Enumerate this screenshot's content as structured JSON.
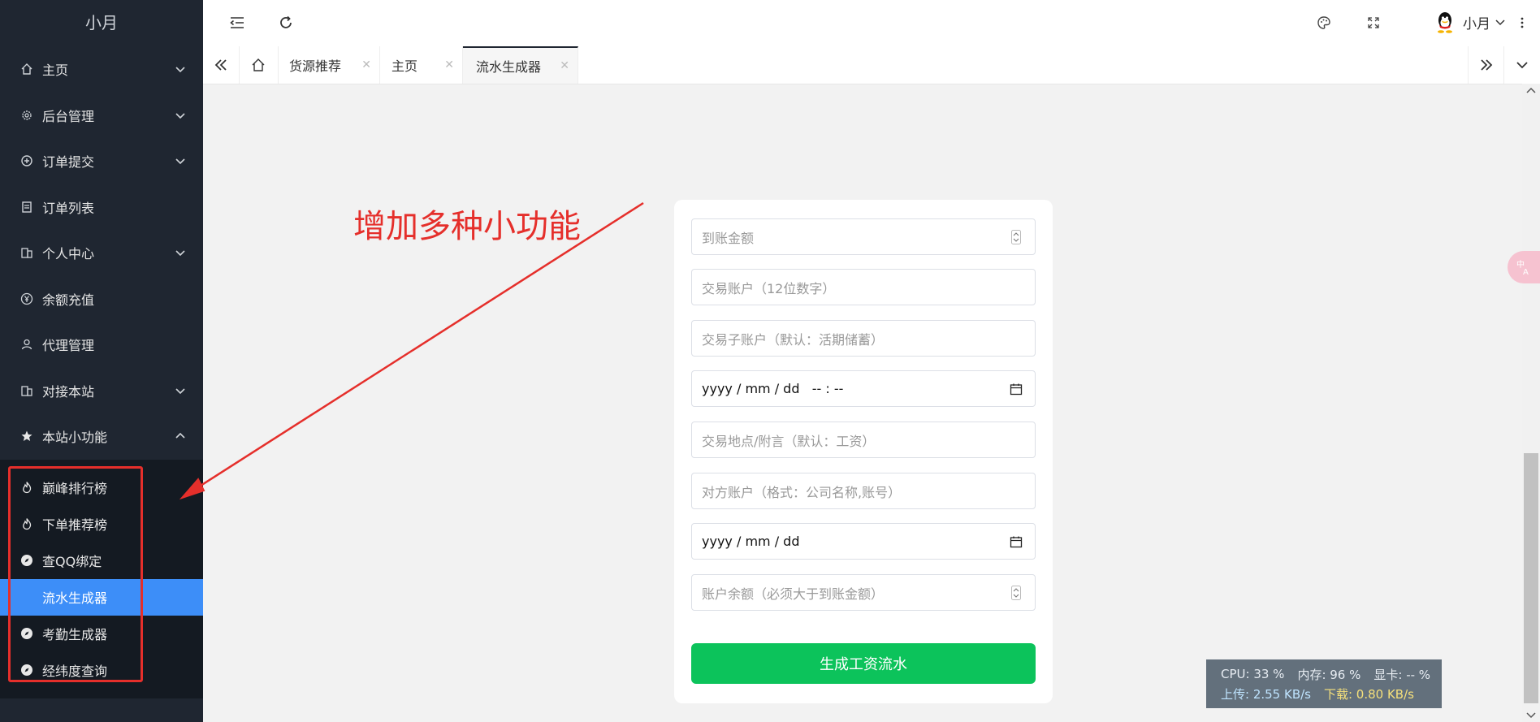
{
  "app": {
    "logo": "小月"
  },
  "sidebar": {
    "items": [
      {
        "label": "主页",
        "icon": "home-icon",
        "expand": "down"
      },
      {
        "label": "后台管理",
        "icon": "gear-icon",
        "expand": "down"
      },
      {
        "label": "订单提交",
        "icon": "plus-circle-icon",
        "expand": "down"
      },
      {
        "label": "订单列表",
        "icon": "document-icon",
        "expand": ""
      },
      {
        "label": "个人中心",
        "icon": "building-icon",
        "expand": "down"
      },
      {
        "label": "余额充值",
        "icon": "yen-icon",
        "expand": ""
      },
      {
        "label": "代理管理",
        "icon": "user-icon",
        "expand": ""
      },
      {
        "label": "对接本站",
        "icon": "building-icon",
        "expand": "down"
      },
      {
        "label": "本站小功能",
        "icon": "star-icon",
        "expand": "up"
      }
    ],
    "subitems": [
      {
        "label": "巅峰排行榜",
        "icon": "fire-icon"
      },
      {
        "label": "下单推荐榜",
        "icon": "fire-icon"
      },
      {
        "label": "查QQ绑定",
        "icon": "compass-icon"
      },
      {
        "label": "流水生成器",
        "icon": "",
        "active": true
      },
      {
        "label": "考勤生成器",
        "icon": "compass-icon"
      },
      {
        "label": "经纬度查询",
        "icon": "compass-icon"
      }
    ]
  },
  "header": {
    "username": "小月"
  },
  "tabs": [
    {
      "label": "货源推荐"
    },
    {
      "label": "主页"
    },
    {
      "label": "流水生成器",
      "active": true
    }
  ],
  "form": {
    "fields": [
      {
        "placeholder": "到账金额",
        "type": "number"
      },
      {
        "placeholder": "交易账户（12位数字）",
        "type": "text"
      },
      {
        "placeholder": "交易子账户（默认：活期储蓄）",
        "type": "text"
      },
      {
        "value": "yyyy / mm / dd   -- : --",
        "type": "datetime"
      },
      {
        "placeholder": "交易地点/附言（默认：工资）",
        "type": "text"
      },
      {
        "placeholder": "对方账户（格式：公司名称,账号）",
        "type": "text"
      },
      {
        "value": "yyyy / mm / dd",
        "type": "date"
      },
      {
        "placeholder": "账户余额（必须大于到账金额）",
        "type": "number"
      }
    ],
    "submit_label": "生成工资流水"
  },
  "annotation": {
    "text": "增加多种小功能",
    "color": "#e52f2b"
  },
  "stats": {
    "cpu": "CPU: 33 %",
    "mem": "内存: 96 %",
    "gpu": "显卡: -- %",
    "upload": "上传: 2.55 KB/s",
    "download": "下载: 0.80 KB/s"
  },
  "colors": {
    "sidebar_bg": "#1f2631",
    "active_blue": "#3d8ef8",
    "submit_green": "#0cc35b"
  }
}
